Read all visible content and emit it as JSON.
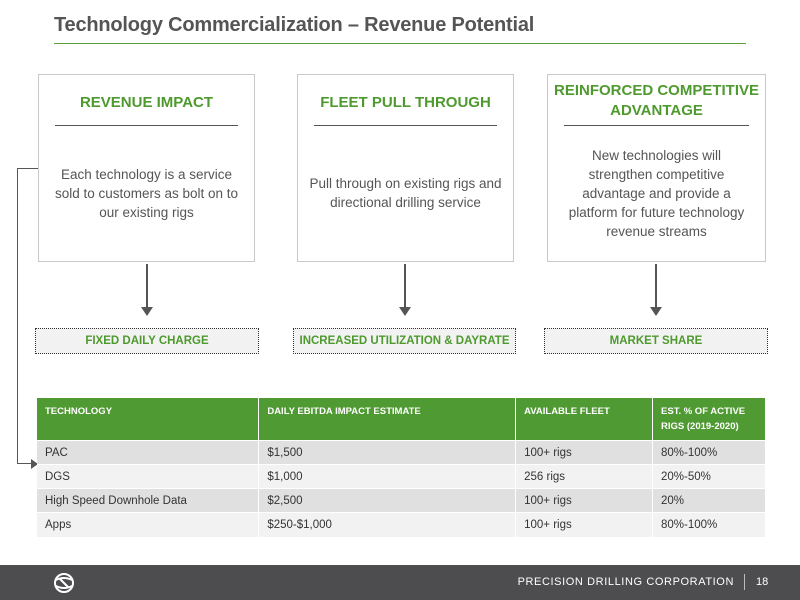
{
  "header": {
    "title": "Technology Commercialization – Revenue Potential"
  },
  "boxes": [
    {
      "title": "REVENUE IMPACT",
      "text": "Each technology is a service sold to customers as bolt on to our existing rigs"
    },
    {
      "title": "FLEET PULL THROUGH",
      "text": "Pull through on existing rigs and directional drilling service"
    },
    {
      "title_line1": "REINFORCED COMPETITIVE",
      "title_line2": "ADVANTAGE",
      "text": "New technologies will strengthen competitive advantage and provide a platform for future technology revenue streams"
    }
  ],
  "tags": [
    "FIXED DAILY CHARGE",
    "INCREASED UTILIZATION & DAYRATE",
    "MARKET SHARE"
  ],
  "table": {
    "headers": [
      "TECHNOLOGY",
      "DAILY EBITDA IMPACT ESTIMATE",
      "AVAILABLE FLEET",
      "EST. % OF ACTIVE RIGS (2019-2020)"
    ],
    "rows": [
      [
        "PAC",
        "$1,500",
        "100+ rigs",
        "80%-100%"
      ],
      [
        "DGS",
        "$1,000",
        "256 rigs",
        "20%-50%"
      ],
      [
        "High Speed Downhole Data",
        "$2,500",
        "100+ rigs",
        "20%"
      ],
      [
        "Apps",
        "$250-$1,000",
        "100+ rigs",
        "80%-100%"
      ]
    ]
  },
  "footer": {
    "company": "PRECISION DRILLING CORPORATION",
    "page_number": "18",
    "logo_icon": "precision-drilling-logo-icon"
  },
  "colors": {
    "accent_green": "#4e9a2e",
    "footer_bg": "#4d4d4f",
    "text_gray": "#555555"
  }
}
